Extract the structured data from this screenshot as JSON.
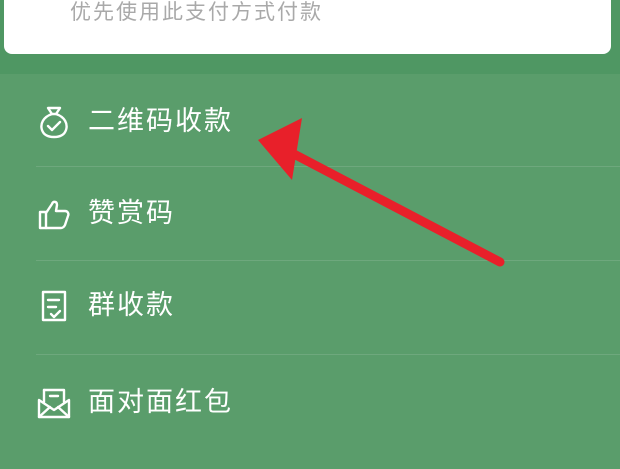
{
  "header": {
    "hint": "优先使用此支付方式付款"
  },
  "menu": {
    "items": [
      {
        "label": "二维码收款",
        "icon": "money-bag-icon"
      },
      {
        "label": "赞赏码",
        "icon": "thumbs-up-icon"
      },
      {
        "label": "群收款",
        "icon": "group-bill-icon"
      },
      {
        "label": "面对面红包",
        "icon": "red-packet-icon"
      }
    ]
  },
  "colors": {
    "menu_background": "#5a9d6b",
    "strip_background": "#4f9763",
    "card_background": "#ffffff",
    "hint_text": "#a9a9a9",
    "item_text": "#ffffff",
    "annotation_arrow": "#e8202a"
  }
}
